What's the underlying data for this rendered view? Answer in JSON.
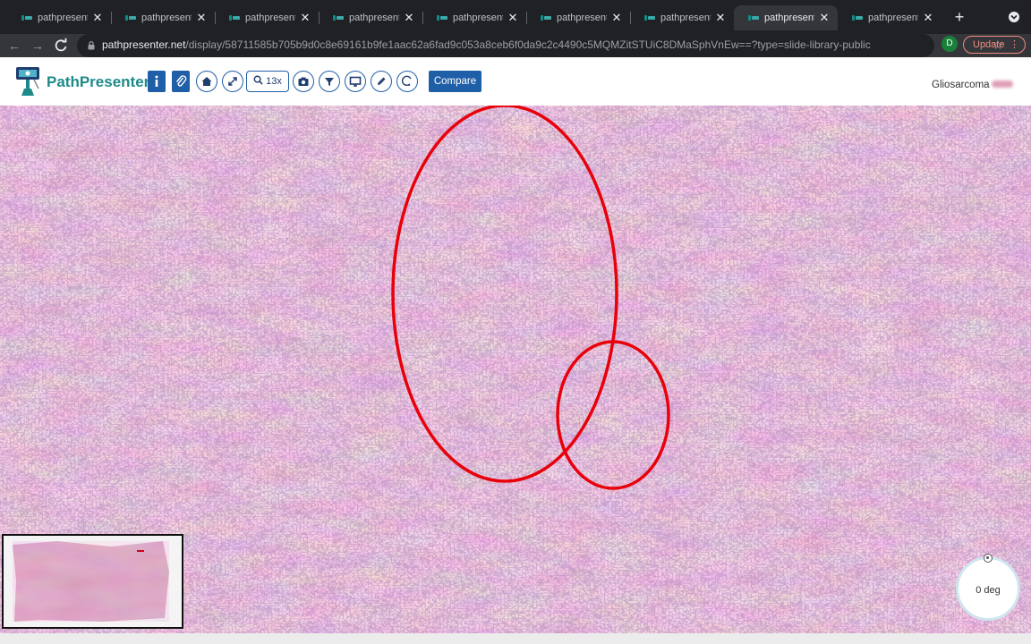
{
  "browser": {
    "tabs": [
      {
        "title": "pathpresenter.net",
        "active": false
      },
      {
        "title": "pathpresenter.net",
        "active": false
      },
      {
        "title": "pathpresenter.net",
        "active": false
      },
      {
        "title": "pathpresenter.net",
        "active": false
      },
      {
        "title": "pathpresenter.net",
        "active": false
      },
      {
        "title": "pathpresenter.net",
        "active": false
      },
      {
        "title": "pathpresenter.net",
        "active": false
      },
      {
        "title": "pathpresenter.net",
        "active": true
      },
      {
        "title": "pathpresenter.net",
        "active": false
      }
    ],
    "url_host": "pathpresenter.net",
    "url_path": "/display/58711585b705b9d0c8e69161b9fe1aac62a6fad9c053a8ceb6f0da9c2c4490c5MQMZitSTUiC8DMaSphVnEw==?type=slide-library-public",
    "profile_initial": "D",
    "update_label": "Update"
  },
  "app": {
    "brand": "PathPresenter",
    "zoom_label": "13x",
    "compare_label": "Compare",
    "slide_name": "Gliosarcoma",
    "rotation_label": "0 deg",
    "brand_color": "#1f8a8a",
    "button_color": "#1f5fa8",
    "annotation_color": "#e8000a"
  }
}
